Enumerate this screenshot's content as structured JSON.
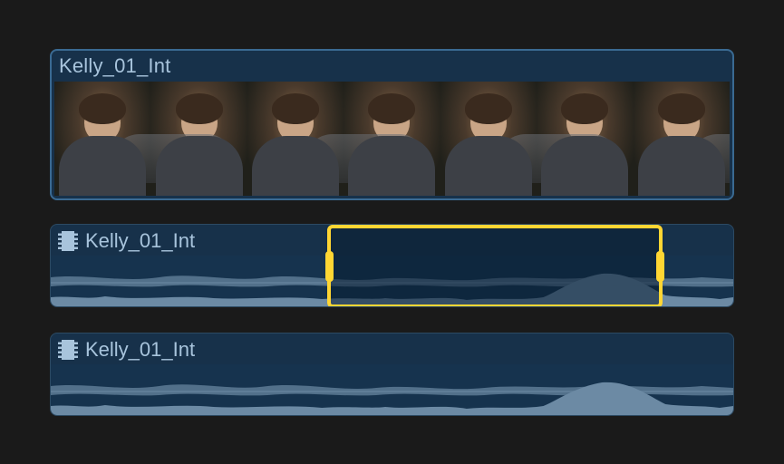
{
  "clips": [
    {
      "name": "Kelly_01_Int",
      "kind": "video"
    },
    {
      "name": "Kelly_01_Int",
      "kind": "audio",
      "range_selected": true,
      "range_start_pct": 40,
      "range_end_pct": 89
    },
    {
      "name": "Kelly_01_Int",
      "kind": "audio"
    }
  ],
  "selection_color": "#ffd633",
  "clip_label_color": "#a8c4dc"
}
